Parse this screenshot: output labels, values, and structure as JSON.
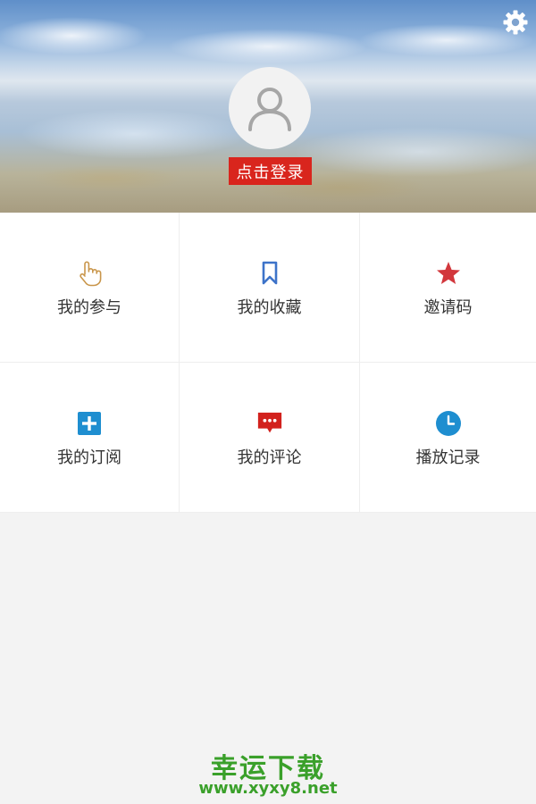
{
  "header": {
    "settings_icon": "gear-icon",
    "avatar_icon": "user-icon",
    "login_label": "点击登录"
  },
  "menu": {
    "items": [
      {
        "label": "我的参与",
        "icon": "hand-pointer-icon",
        "color": "#c9964b"
      },
      {
        "label": "我的收藏",
        "icon": "bookmark-icon",
        "color": "#3d73c9"
      },
      {
        "label": "邀请码",
        "icon": "star-icon",
        "color": "#d2373c"
      },
      {
        "label": "我的订阅",
        "icon": "plus-square-icon",
        "color": "#1e8ed0"
      },
      {
        "label": "我的评论",
        "icon": "comment-icon",
        "color": "#d2211d"
      },
      {
        "label": "播放记录",
        "icon": "clock-icon",
        "color": "#1e8ed0"
      }
    ]
  },
  "watermark": {
    "title": "幸运下载",
    "url": "www.xyxy8.net"
  }
}
